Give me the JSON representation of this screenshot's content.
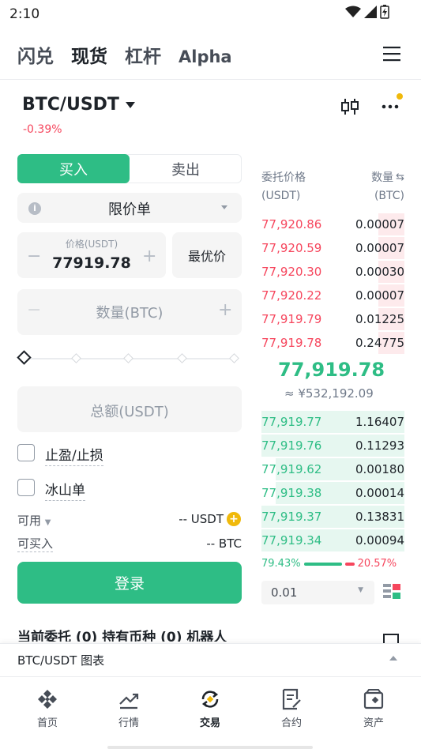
{
  "status": {
    "time": "2:10"
  },
  "top_tabs": [
    {
      "label": "闪兑",
      "active": false
    },
    {
      "label": "现货",
      "active": true
    },
    {
      "label": "杠杆",
      "active": false
    },
    {
      "label": "Alpha",
      "active": false
    }
  ],
  "pair": {
    "name": "BTC/USDT",
    "change": "-0.39%"
  },
  "trade_form": {
    "buy_label": "买入",
    "sell_label": "卖出",
    "order_type": "限价单",
    "price_label": "价格(USDT)",
    "price_value": "77919.78",
    "best_price_label": "最优价",
    "qty_placeholder": "数量(BTC)",
    "total_placeholder": "总额(USDT)",
    "tpsl_label": "止盈/止损",
    "iceberg_label": "冰山单",
    "available_label": "可用",
    "available_value": "-- USDT",
    "can_buy_label": "可买入",
    "can_buy_value": "-- BTC",
    "login_label": "登录"
  },
  "orderbook": {
    "price_header": "委托价格",
    "price_unit": "(USDT)",
    "qty_header": "数量",
    "qty_unit": "(BTC)",
    "asks": [
      {
        "price": "77,920.86",
        "qty": "0.00007",
        "depth": 0.18
      },
      {
        "price": "77,920.59",
        "qty": "0.00007",
        "depth": 0.18
      },
      {
        "price": "77,920.30",
        "qty": "0.00030",
        "depth": 0.18
      },
      {
        "price": "77,920.22",
        "qty": "0.00007",
        "depth": 0.18
      },
      {
        "price": "77,919.79",
        "qty": "0.01225",
        "depth": 0.18
      },
      {
        "price": "77,919.78",
        "qty": "0.24775",
        "depth": 0.18
      }
    ],
    "mid_price": "77,919.78",
    "mid_cny": "≈ ¥532,192.09",
    "bids": [
      {
        "price": "77,919.77",
        "qty": "1.16407",
        "depth": 1.0
      },
      {
        "price": "77,919.76",
        "qty": "0.11293",
        "depth": 1.0
      },
      {
        "price": "77,919.62",
        "qty": "0.00180",
        "depth": 0.9
      },
      {
        "price": "77,919.38",
        "qty": "0.00014",
        "depth": 0.9
      },
      {
        "price": "77,919.37",
        "qty": "0.13831",
        "depth": 1.0
      },
      {
        "price": "77,919.34",
        "qty": "0.00094",
        "depth": 1.0
      }
    ],
    "buy_ratio": "79.43%",
    "sell_ratio": "20.57%",
    "precision": "0.01"
  },
  "lower_tabs_text": "当前委托 (0)     持有币种 (0)     机器人",
  "chart_bar_label": "BTC/USDT 图表",
  "nav": [
    {
      "label": "首页",
      "icon": "home-icon",
      "active": false
    },
    {
      "label": "行情",
      "icon": "markets-icon",
      "active": false
    },
    {
      "label": "交易",
      "icon": "trade-icon",
      "active": true
    },
    {
      "label": "合约",
      "icon": "futures-icon",
      "active": false
    },
    {
      "label": "资产",
      "icon": "wallet-icon",
      "active": false
    }
  ],
  "colors": {
    "green": "#2ebd85",
    "red": "#f6465d",
    "yellow": "#f0b90b"
  }
}
